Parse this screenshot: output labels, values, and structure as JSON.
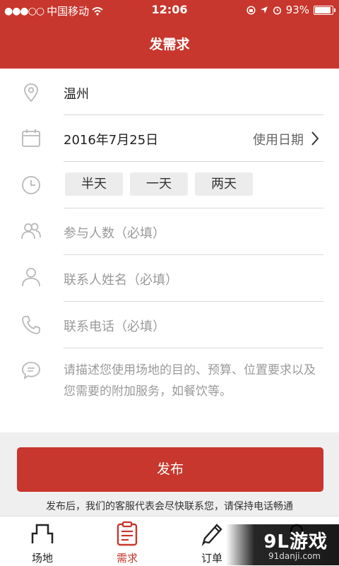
{
  "status_bar": {
    "signal": "●●●○○",
    "carrier": "中国移动",
    "time": "12:06",
    "battery": "93%",
    "battery_level": 0.93
  },
  "header": {
    "title": "发需求"
  },
  "form": {
    "location": "温州",
    "date_value": "2016年7月25日",
    "date_label": "使用日期",
    "duration_options": [
      "半天",
      "一天",
      "两天"
    ],
    "participants_placeholder": "参与人数（必填）",
    "contact_name_placeholder": "联系人姓名（必填）",
    "contact_phone_placeholder": "联系电话（必填）",
    "requirements_placeholder": "请描述您使用场地的目的、预算、位置要求以及您需要的附加服务，如餐饮等。"
  },
  "publish_button": "发布",
  "note": "发布后，我们的客服代表会尽快联系您，请保持电话畅通",
  "tabs": [
    {
      "label": "场地",
      "icon": "venue-icon"
    },
    {
      "label": "需求",
      "icon": "clipboard-icon"
    },
    {
      "label": "订单",
      "icon": "pencil-icon"
    },
    {
      "label": "",
      "icon": "profile-icon"
    }
  ],
  "watermark": {
    "brand": "9L游戏",
    "url": "91danji.com"
  },
  "colors": {
    "accent": "#c7372d",
    "icon_gray": "#b8b8b8",
    "placeholder": "#9a9a9a"
  }
}
